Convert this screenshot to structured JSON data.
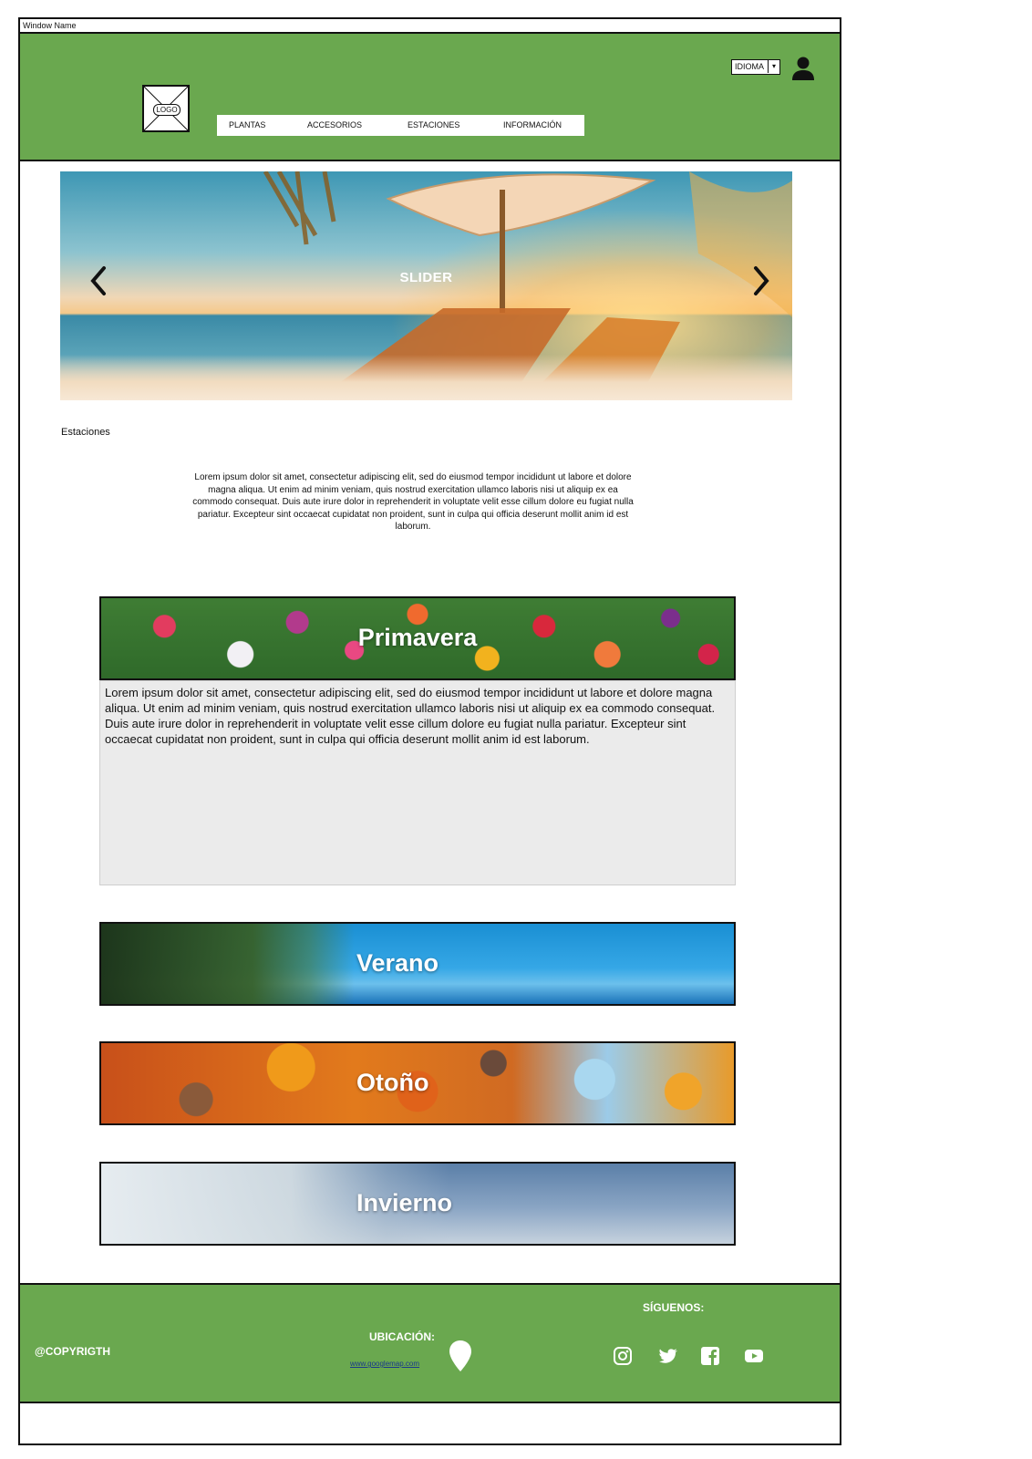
{
  "window": {
    "title": "Window Name"
  },
  "header": {
    "logo_label": "LOGO",
    "nav": [
      {
        "label": "PLANTAS"
      },
      {
        "label": "ACCESORIOS"
      },
      {
        "label": "ESTACIONES"
      },
      {
        "label": "INFORMACIÓN"
      }
    ],
    "language_select": {
      "value": "IDIOMA",
      "arrow": "▾"
    },
    "user_icon": "user-icon"
  },
  "slider": {
    "title": "SLIDER",
    "prev_icon": "chevron-left-icon",
    "next_icon": "chevron-right-icon"
  },
  "main": {
    "section_label": "Estaciones",
    "intro": "Lorem ipsum dolor sit amet, consectetur adipiscing elit, sed do eiusmod tempor incididunt ut labore et dolore magna aliqua. Ut enim ad minim veniam, quis nostrud exercitation ullamco laboris nisi ut aliquip ex ea commodo consequat. Duis aute irure dolor in reprehenderit in voluptate velit esse cillum dolore eu fugiat nulla pariatur. Excepteur sint occaecat cupidatat non proident, sunt in culpa qui officia deserunt mollit anim id est laborum.",
    "seasons": [
      {
        "name": "Primavera",
        "expanded": true
      },
      {
        "name": "Verano",
        "expanded": false
      },
      {
        "name": "Otoño",
        "expanded": false
      },
      {
        "name": "Invierno",
        "expanded": false
      }
    ],
    "spring_text": "Lorem ipsum dolor sit amet, consectetur adipiscing elit, sed do eiusmod tempor incididunt ut labore et dolore magna aliqua. Ut enim ad minim veniam, quis nostrud exercitation ullamco laboris nisi ut aliquip ex ea commodo consequat. Duis aute irure dolor in reprehenderit in voluptate velit esse cillum dolore eu fugiat nulla pariatur. Excepteur sint occaecat cupidatat non proident, sunt in culpa qui officia deserunt mollit anim id est laborum."
  },
  "footer": {
    "copyright": "@COPYRIGTH",
    "ubicacion_label": "UBICACIÓN:",
    "map_link": "www.googlemap.com",
    "follow_label": "SÍGUENOS:",
    "social": [
      "instagram-icon",
      "twitter-icon",
      "facebook-icon",
      "youtube-icon"
    ]
  },
  "colors": {
    "brand_green": "#6aa84f",
    "panel_gray": "#ebebeb"
  }
}
